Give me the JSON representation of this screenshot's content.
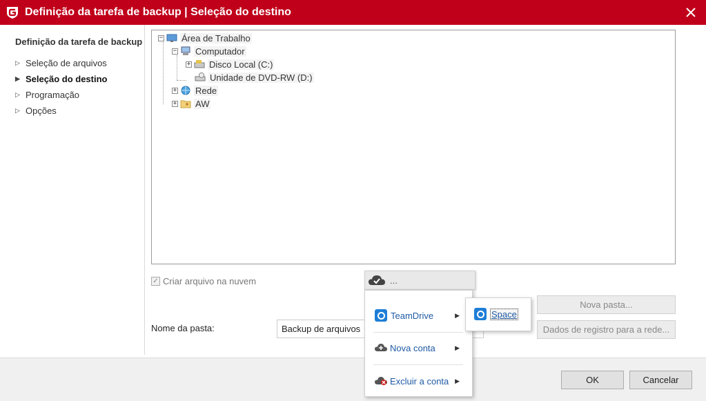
{
  "window": {
    "title": "Definição da tarefa de backup | Seleção do destino",
    "close_label": "✕"
  },
  "nav": {
    "header": "Definição da tarefa de backup",
    "items": [
      {
        "label": "Seleção de arquivos",
        "active": false
      },
      {
        "label": "Seleção do destino",
        "active": true
      },
      {
        "label": "Programação",
        "active": false
      },
      {
        "label": "Opções",
        "active": false
      }
    ]
  },
  "tree": {
    "desktop": "Área de Trabalho",
    "computer": "Computador",
    "local_disk": "Disco Local (C:)",
    "dvd_drive": "Unidade de DVD-RW (D:)",
    "network": "Rede",
    "user": "AW"
  },
  "cloud_option": {
    "label": "Criar arquivo na nuvem",
    "checked": true
  },
  "folder": {
    "label": "Nome da pasta:",
    "value": "Backup de arquivos"
  },
  "buttons": {
    "new_folder": "Nova pasta...",
    "network_login": "Dados de registro para a rede...",
    "ok": "OK",
    "cancel": "Cancelar"
  },
  "cloud_menu": {
    "header": "...",
    "items": [
      {
        "label": "TeamDrive",
        "icon": "teamdrive-icon"
      },
      {
        "label": "Nova conta",
        "icon": "cloud-add-icon"
      },
      {
        "label": "Excluir a conta",
        "icon": "cloud-delete-icon"
      }
    ],
    "submenu_item": "Space"
  },
  "colors": {
    "brand": "#c0001a",
    "link": "#1f5aa5"
  }
}
